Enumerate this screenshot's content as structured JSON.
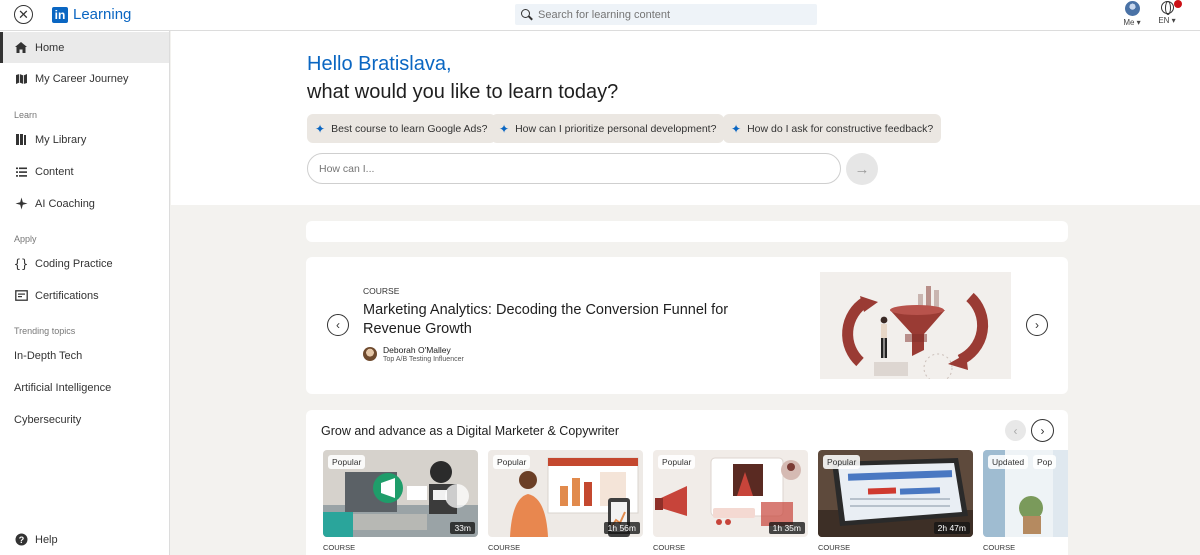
{
  "topbar": {
    "app_name": "Learning",
    "logo_mark": "in",
    "search_placeholder": "Search for learning content",
    "me_label": "Me ▾",
    "lang_label": "EN ▾"
  },
  "sidebar": {
    "items": [
      {
        "label": "Home",
        "icon": "home-icon"
      },
      {
        "label": "My Career Journey",
        "icon": "map-icon"
      }
    ],
    "learn_section": "Learn",
    "learn_items": [
      {
        "label": "My Library",
        "icon": "library-icon"
      },
      {
        "label": "Content",
        "icon": "list-icon"
      },
      {
        "label": "AI Coaching",
        "icon": "sparkle-icon"
      }
    ],
    "apply_section": "Apply",
    "apply_items": [
      {
        "label": "Coding Practice",
        "icon": "braces-icon"
      },
      {
        "label": "Certifications",
        "icon": "certificate-icon"
      }
    ],
    "trending_section": "Trending topics",
    "trending_items": [
      "In-Depth Tech",
      "Artificial Intelligence",
      "Cybersecurity"
    ],
    "help_label": "Help"
  },
  "hero": {
    "greeting": "Hello Bratislava,",
    "question": "what would you like to learn today?",
    "chips": [
      "Best course to learn Google Ads?",
      "How can I prioritize personal development?",
      "How do I ask for constructive feedback?"
    ],
    "ask_placeholder": "How can I..."
  },
  "feature": {
    "type": "COURSE",
    "title": "Marketing Analytics: Decoding the Conversion Funnel for Revenue Growth",
    "author_name": "Deborah O'Malley",
    "author_role": "Top A/B Testing Influencer"
  },
  "row": {
    "title": "Grow and advance as a Digital Marketer & Copywriter",
    "courses": [
      {
        "badge": "Popular",
        "duration": "33m",
        "type": "COURSE"
      },
      {
        "badge": "Popular",
        "duration": "1h 56m",
        "type": "COURSE"
      },
      {
        "badge": "Popular",
        "duration": "1h 35m",
        "type": "COURSE"
      },
      {
        "badge": "Popular",
        "duration": "2h 47m",
        "type": "COURSE"
      },
      {
        "badge": "Updated",
        "badge2": "Pop",
        "duration": "",
        "type": "COURSE"
      }
    ]
  },
  "colors": {
    "brand": "#0a66c2",
    "accent_red": "#9a3b34"
  }
}
